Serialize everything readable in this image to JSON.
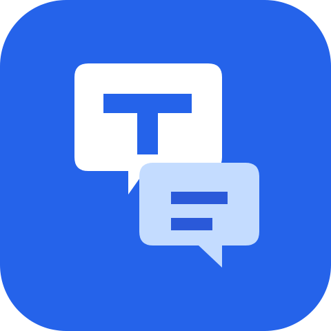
{
  "icon": {
    "semantic_name": "chat-translate-app-icon",
    "glyph_letter": "T",
    "colors": {
      "background": "#2563EA",
      "primary_bubble": "#FFFFFF",
      "secondary_bubble": "#C4DCFF",
      "glyph_t": "#2563EA",
      "glyph_lines": "#2A59D9"
    }
  }
}
